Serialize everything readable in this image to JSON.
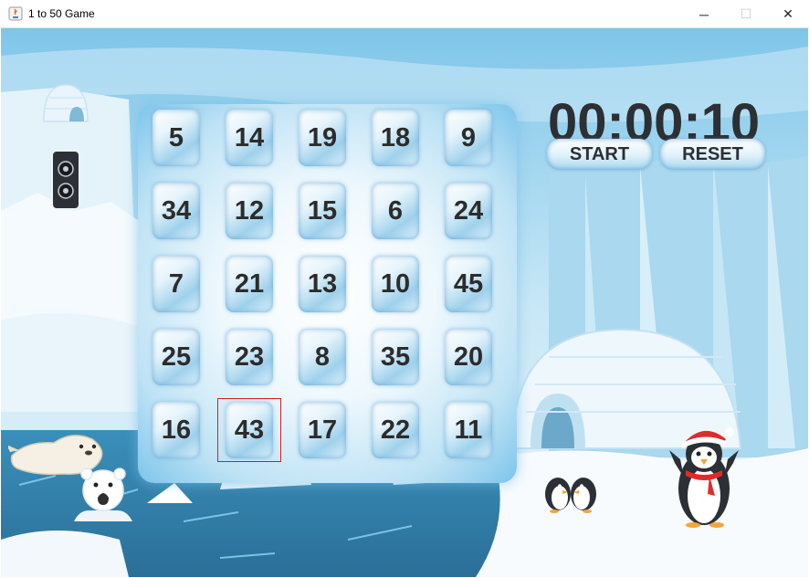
{
  "window": {
    "title": "1 to 50 Game",
    "controls": {
      "minimize": "─",
      "maximize": "☐",
      "close": "✕"
    }
  },
  "timer": "00:00:10",
  "buttons": {
    "start": "START",
    "reset": "RESET"
  },
  "board": {
    "rows": [
      [
        "5",
        "14",
        "19",
        "18",
        "9"
      ],
      [
        "34",
        "12",
        "15",
        "6",
        "24"
      ],
      [
        "7",
        "21",
        "13",
        "10",
        "45"
      ],
      [
        "25",
        "23",
        "8",
        "35",
        "20"
      ],
      [
        "16",
        "43",
        "17",
        "22",
        "11"
      ]
    ],
    "selected": "43"
  },
  "colors": {
    "selection_border": "#d32020",
    "timer_text": "#2c2f33",
    "tile_text": "#2c2c2c",
    "sky": "#7fc6e9",
    "water": "#2f7fa8"
  },
  "icons": [
    "java-app-icon",
    "igloo-icon",
    "speaker-icon",
    "seal-icon",
    "polar-bear-icon",
    "penguin-pair-icon",
    "santa-penguin-icon"
  ]
}
